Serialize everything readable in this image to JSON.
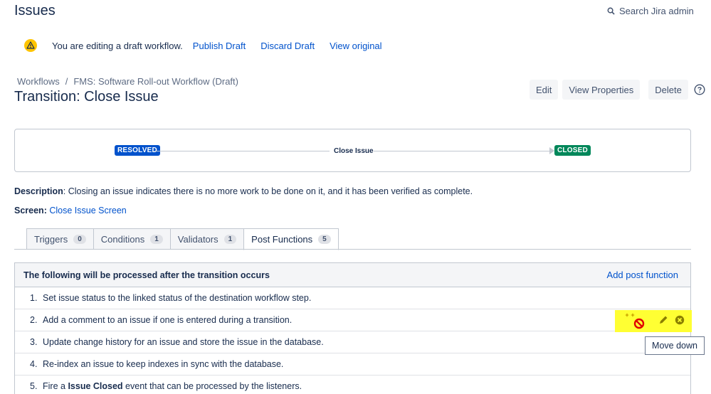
{
  "header": {
    "title": "Issues",
    "search_label": "Search Jira admin"
  },
  "draft": {
    "message": "You are editing a draft workflow.",
    "publish": "Publish Draft",
    "discard": "Discard Draft",
    "view_original": "View original"
  },
  "breadcrumb": {
    "root": "Workflows",
    "sep": "/",
    "current": "FMS: Software Roll-out Workflow (Draft)"
  },
  "transition_title": "Transition: Close Issue",
  "actions": {
    "edit": "Edit",
    "view_properties": "View Properties",
    "delete": "Delete"
  },
  "diagram": {
    "from_status": "RESOLVED",
    "transition": "Close Issue",
    "to_status": "CLOSED",
    "from_color": "#0052cc",
    "to_color": "#00875a"
  },
  "description": {
    "label": "Description",
    "text": ": Closing an issue indicates there is no more work to be done on it, and it has been verified as complete."
  },
  "screen": {
    "label": "Screen",
    "sep": ":",
    "value": "Close Issue Screen"
  },
  "tabs": [
    {
      "label": "Triggers",
      "count": "0"
    },
    {
      "label": "Conditions",
      "count": "1"
    },
    {
      "label": "Validators",
      "count": "1"
    },
    {
      "label": "Post Functions",
      "count": "5"
    }
  ],
  "post_functions": {
    "header": "The following will be processed after the transition occurs",
    "add_link": "Add post function",
    "items": [
      {
        "num": "1.",
        "text": "Set issue status to the linked status of the destination workflow step."
      },
      {
        "num": "2.",
        "text": "Add a comment to an issue if one is entered during a transition."
      },
      {
        "num": "3.",
        "text": "Update change history for an issue and store the issue in the database."
      },
      {
        "num": "4.",
        "text": "Re-index an issue to keep indexes in sync with the database."
      },
      {
        "num": "5.",
        "pre": "Fire a ",
        "bold": "Issue Closed",
        "post": " event that can be processed by the listeners."
      }
    ]
  },
  "tooltip": "Move down",
  "highlight_color": "#ffff33"
}
